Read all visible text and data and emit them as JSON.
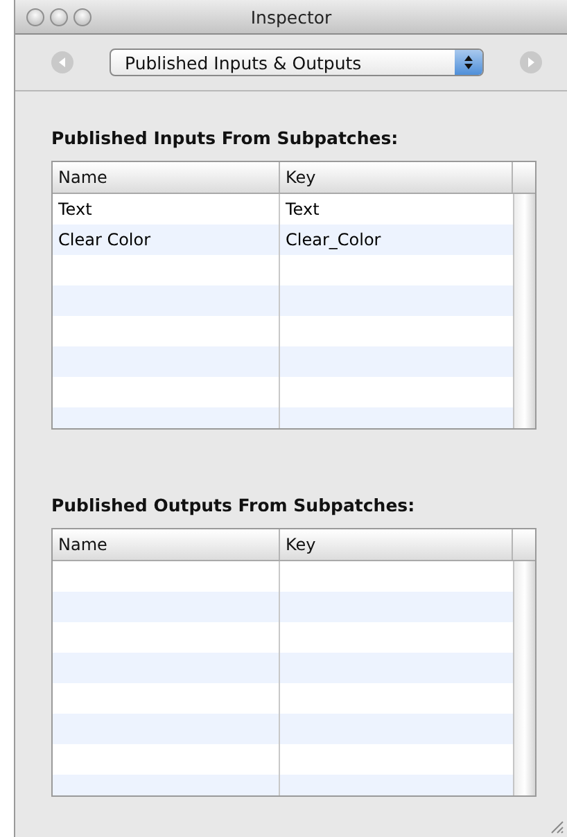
{
  "window": {
    "title": "Inspector"
  },
  "toolbar": {
    "popup": {
      "value": "Published Inputs & Outputs"
    }
  },
  "sections": [
    {
      "title": "Published Inputs From Subpatches:",
      "columns": [
        "Name",
        "Key"
      ],
      "rows": [
        {
          "name": "Text",
          "key": "Text"
        },
        {
          "name": "Clear Color",
          "key": "Clear_Color"
        }
      ]
    },
    {
      "title": "Published Outputs From Subpatches:",
      "columns": [
        "Name",
        "Key"
      ]
    }
  ]
}
